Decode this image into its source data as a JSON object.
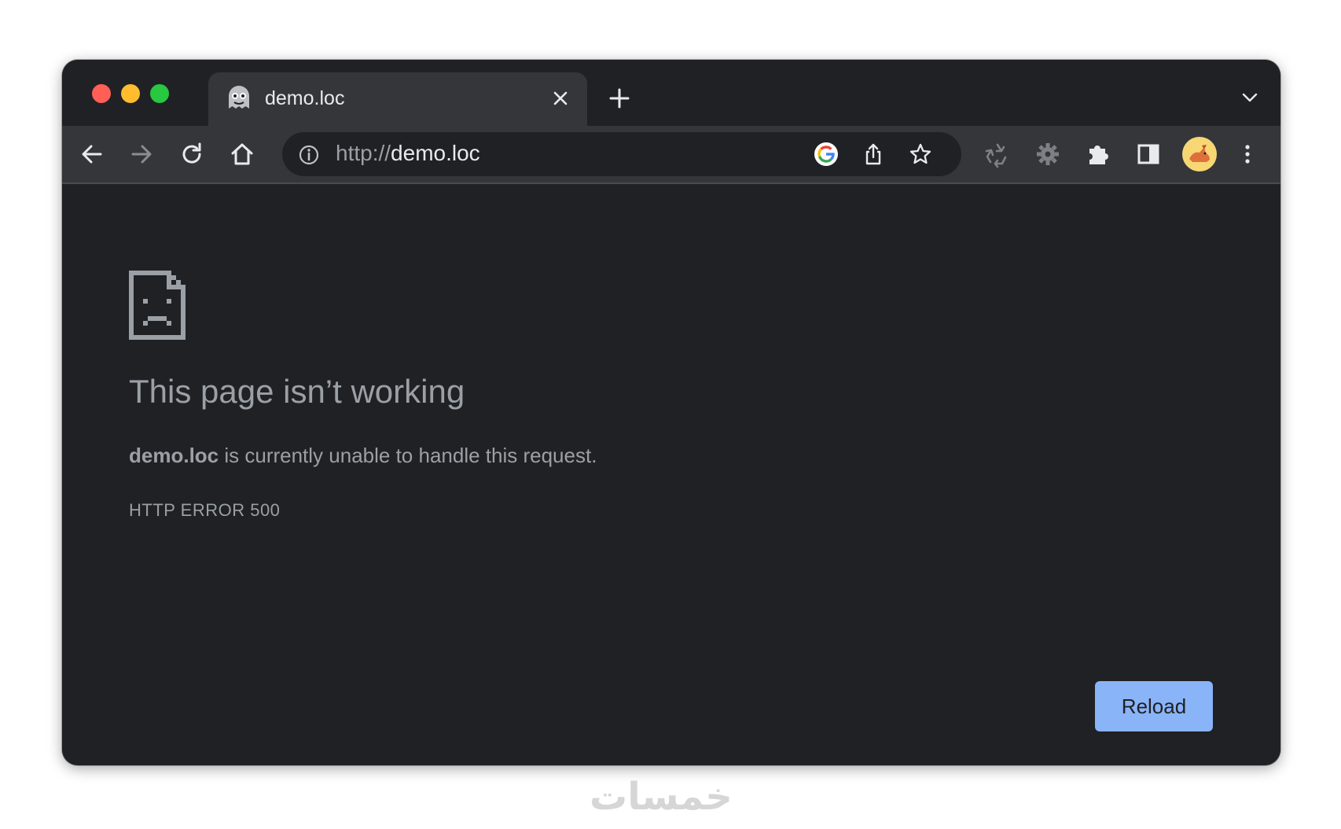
{
  "window_controls": {
    "close_color": "#ff5f57",
    "minimize_color": "#febc2e",
    "zoom_color": "#28c840"
  },
  "tab": {
    "title": "demo.loc",
    "favicon": "ghost-icon"
  },
  "toolbar": {
    "url_scheme": "http://",
    "url_host": "demo.loc",
    "icons": [
      "back-arrow-icon",
      "forward-arrow-icon",
      "reload-icon",
      "home-icon",
      "info-icon",
      "google-icon",
      "share-icon",
      "star-icon",
      "recycle-icon",
      "gear-icon",
      "puzzle-icon",
      "side-panel-icon",
      "avatar",
      "kebab-menu-icon"
    ]
  },
  "error_page": {
    "icon": "sad-document-icon",
    "heading": "This page isn’t working",
    "host": "demo.loc",
    "message_rest": " is currently unable to handle this request.",
    "error_code": "HTTP ERROR 500",
    "reload_label": "Reload",
    "accent_color": "#8ab4f8"
  },
  "watermark": "خمسات"
}
